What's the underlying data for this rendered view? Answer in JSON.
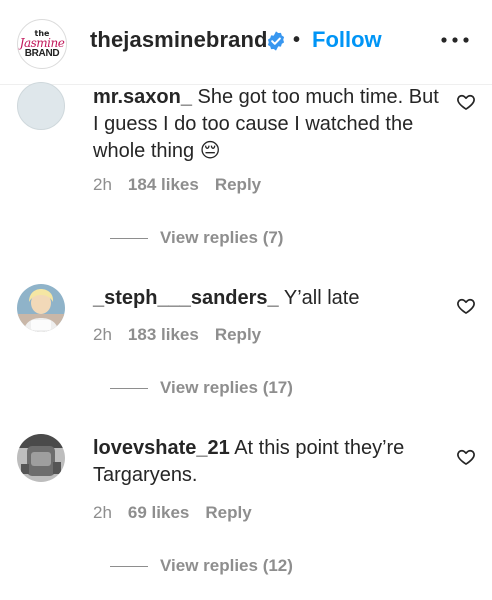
{
  "header": {
    "logo_line1": "the",
    "logo_line2": "Jasmine",
    "logo_line3": "BRAND",
    "username": "thejasminebrand",
    "separator": "•",
    "follow_label": "Follow"
  },
  "comments": [
    {
      "username": "mr.saxon_",
      "text": " She got too much time. But I guess I do too cause I watched the whole thing 😔",
      "time": "2h",
      "likes": "184 likes",
      "reply_label": "Reply",
      "view_replies": "View replies (7)"
    },
    {
      "username": "_steph___sanders_",
      "text": " Y’all late",
      "time": "2h",
      "likes": "183 likes",
      "reply_label": "Reply",
      "view_replies": "View replies (17)"
    },
    {
      "username": "lovevshate_21",
      "text": " At this point they’re Targaryens.",
      "time": "2h",
      "likes": "69 likes",
      "reply_label": "Reply",
      "view_replies": "View replies (12)"
    }
  ],
  "colors": {
    "link_blue": "#0095f6",
    "text": "#262626",
    "muted": "#8e8e8e",
    "verified_blue": "#3897f0"
  },
  "icons": [
    "verified-badge-icon",
    "more-options-icon",
    "heart-icon"
  ]
}
